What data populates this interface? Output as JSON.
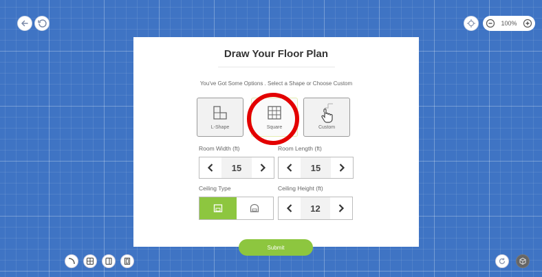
{
  "top_left": {
    "back_icon": "arrow-left-icon",
    "undo_icon": "undo-icon"
  },
  "top_right": {
    "locate_icon": "crosshair-icon",
    "zoom_level": "100%"
  },
  "card": {
    "title": "Draw Your Floor Plan",
    "subtitle": "You've Got Some Options . Select a Shape or Choose Custom",
    "shapes": [
      {
        "label": "L-Shape",
        "icon": "l-shape-icon"
      },
      {
        "label": "Square",
        "icon": "square-grid-icon",
        "selected": true
      },
      {
        "label": "Custom",
        "icon": "custom-shape-icon"
      }
    ],
    "room_width": {
      "label": "Room Width (ft)",
      "value": "15"
    },
    "room_length": {
      "label": "Room Length (ft)",
      "value": "15"
    },
    "ceiling_type": {
      "label": "Ceiling Type",
      "options": [
        "flat-ceiling-icon",
        "vaulted-ceiling-icon"
      ],
      "selected_index": 0
    },
    "ceiling_height": {
      "label": "Ceiling Height (ft)",
      "value": "12"
    },
    "submit_label": "Submit"
  },
  "bottom_tools": [
    "curve-wall-icon",
    "window-icon",
    "door-icon",
    "panel-icon"
  ],
  "bottom_right": [
    "rotate-icon",
    "3d-view-icon"
  ],
  "colors": {
    "accent_green": "#8dc63f",
    "background_blue": "#3f74c4",
    "highlight_red": "#e30000"
  }
}
